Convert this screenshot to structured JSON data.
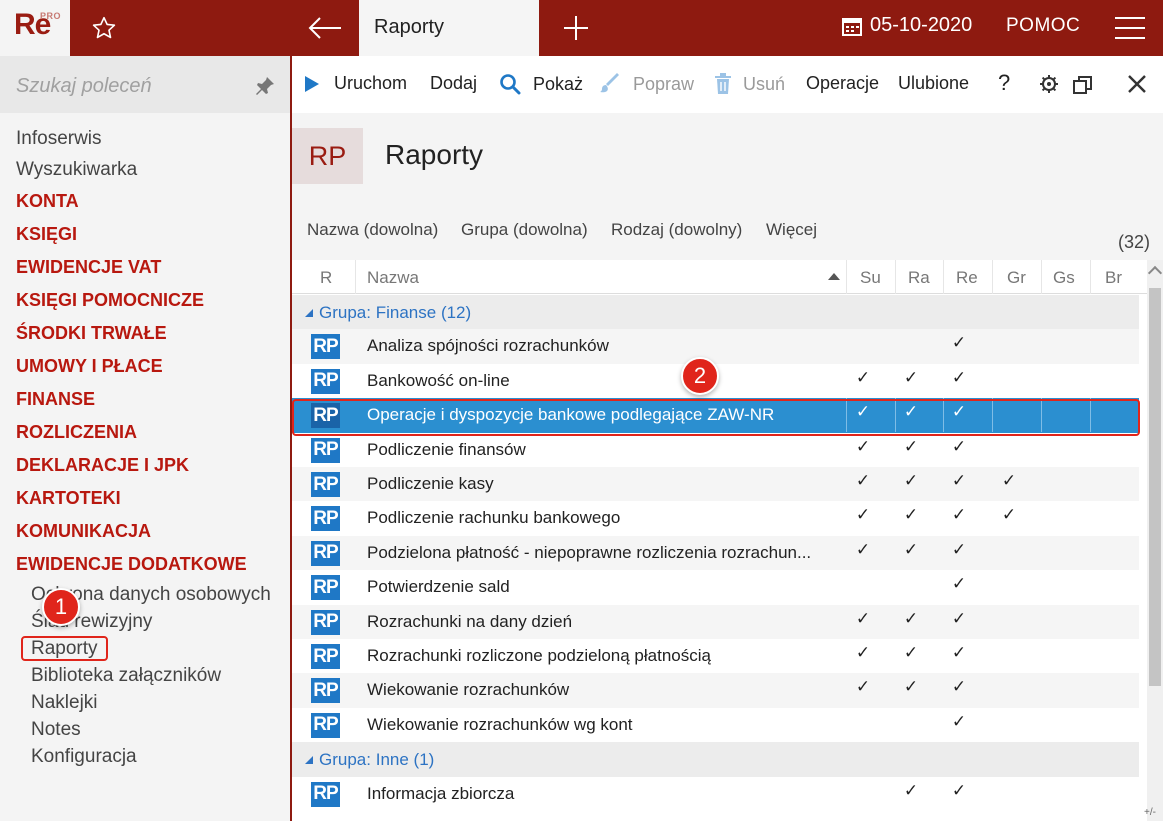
{
  "app": {
    "logo": "Re",
    "logo_badge": "PRO",
    "active_tab": "Raporty",
    "date": "05-10-2020",
    "help": "POMOC"
  },
  "sidebar": {
    "search_placeholder": "Szukaj poleceń",
    "items": [
      "Infoserwis",
      "Wyszukiwarka"
    ],
    "categories": [
      "KONTA",
      "KSIĘGI",
      "EWIDENCJE VAT",
      "KSIĘGI POMOCNICZE",
      "ŚRODKI TRWAŁE",
      "UMOWY I PŁACE",
      "FINANSE",
      "ROZLICZENIA",
      "DEKLARACJE I JPK",
      "KARTOTEKI",
      "KOMUNIKACJA",
      "EWIDENCJE DODATKOWE"
    ],
    "subitems": [
      "Ochrona danych osobowych",
      "Ślad rewizyjny",
      "Raporty",
      "Biblioteka załączników",
      "Naklejki",
      "Notes",
      "Konfiguracja"
    ]
  },
  "toolbar": {
    "run": "Uruchom",
    "add": "Dodaj",
    "show": "Pokaż",
    "edit": "Popraw",
    "delete": "Usuń",
    "operations": "Operacje",
    "favorites": "Ulubione",
    "help": "?"
  },
  "header": {
    "badge": "RP",
    "title": "Raporty"
  },
  "filters": {
    "name": "Nazwa (dowolna)",
    "group": "Grupa (dowolna)",
    "kind": "Rodzaj (dowolny)",
    "more": "Więcej",
    "count": "(32)"
  },
  "grid": {
    "columns": [
      "R",
      "Nazwa",
      "Su",
      "Ra",
      "Re",
      "Gr",
      "Gs",
      "Br"
    ],
    "groups": [
      {
        "prefix": "Grupa:",
        "name": "Finanse",
        "count": "(12)",
        "rows": [
          {
            "name": "Analiza spójności rozrachunków",
            "checks": [
              false,
              false,
              true,
              false,
              false,
              false
            ]
          },
          {
            "name": "Bankowość on-line",
            "checks": [
              true,
              true,
              true,
              false,
              false,
              false
            ]
          },
          {
            "name": "Operacje i dyspozycje bankowe podlegające ZAW-NR",
            "checks": [
              true,
              true,
              true,
              false,
              false,
              false
            ],
            "selected": true
          },
          {
            "name": "Podliczenie finansów",
            "checks": [
              true,
              true,
              true,
              false,
              false,
              false
            ]
          },
          {
            "name": "Podliczenie kasy",
            "checks": [
              true,
              true,
              true,
              true,
              false,
              false
            ]
          },
          {
            "name": "Podliczenie rachunku bankowego",
            "checks": [
              true,
              true,
              true,
              true,
              false,
              false
            ]
          },
          {
            "name": "Podzielona płatność - niepoprawne rozliczenia rozrachun...",
            "checks": [
              true,
              true,
              true,
              false,
              false,
              false
            ]
          },
          {
            "name": "Potwierdzenie sald",
            "checks": [
              false,
              false,
              true,
              false,
              false,
              false
            ]
          },
          {
            "name": "Rozrachunki na dany dzień",
            "checks": [
              true,
              true,
              true,
              false,
              false,
              false
            ]
          },
          {
            "name": "Rozrachunki rozliczone podzieloną płatnością",
            "checks": [
              true,
              true,
              true,
              false,
              false,
              false
            ]
          },
          {
            "name": "Wiekowanie rozrachunków",
            "checks": [
              true,
              true,
              true,
              false,
              false,
              false
            ]
          },
          {
            "name": "Wiekowanie rozrachunków wg kont",
            "checks": [
              false,
              false,
              true,
              false,
              false,
              false
            ]
          }
        ]
      },
      {
        "prefix": "Grupa:",
        "name": "Inne",
        "count": "(1)",
        "rows": [
          {
            "name": "Informacja zbiorcza",
            "checks": [
              false,
              true,
              true,
              false,
              false,
              false
            ]
          }
        ]
      }
    ],
    "icon_label": "RP",
    "check_glyph": "✓"
  },
  "scroll_corner": "+/-",
  "callouts": [
    "1",
    "2"
  ],
  "colors": {
    "brand": "#8e1a10",
    "category": "#b8180f",
    "selection": "#2b8fd0",
    "icon": "#1f78c6",
    "group_text": "#2d73c3",
    "callout": "#e0251b"
  }
}
